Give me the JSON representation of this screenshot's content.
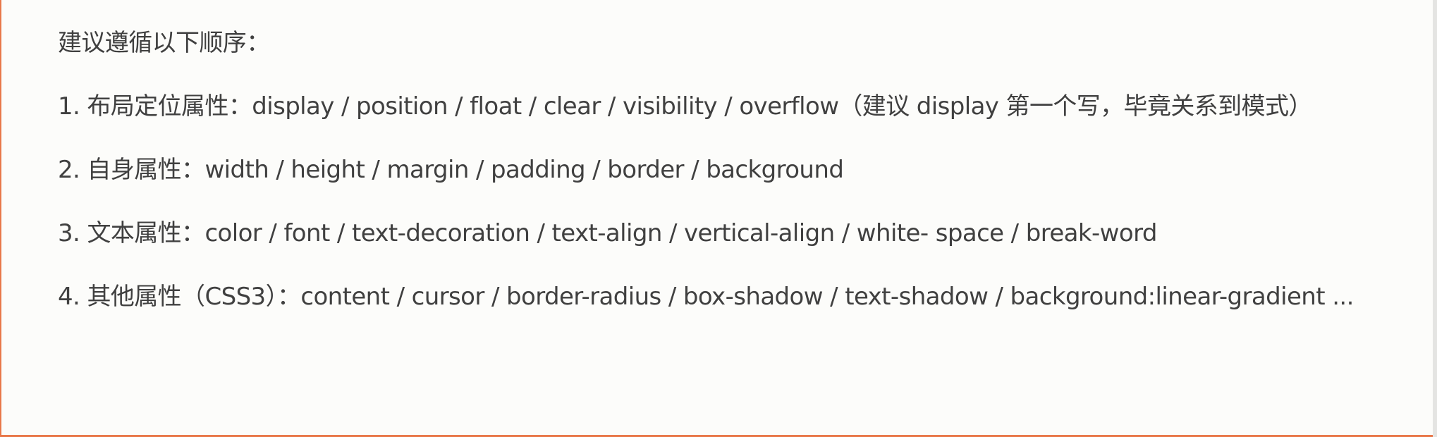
{
  "intro": "建议遵循以下顺序：",
  "items": [
    "1. 布局定位属性：display / position / float / clear / visibility / overflow（建议 display 第一个写，毕竟关系到模式）",
    "2. 自身属性：width / height / margin / padding / border / background",
    "3. 文本属性：color / font / text-decoration / text-align / vertical-align / white- space / break-word",
    "4. 其他属性（CSS3）：content / cursor / border-radius / box-shadow / text-shadow / background:linear-gradient ..."
  ]
}
